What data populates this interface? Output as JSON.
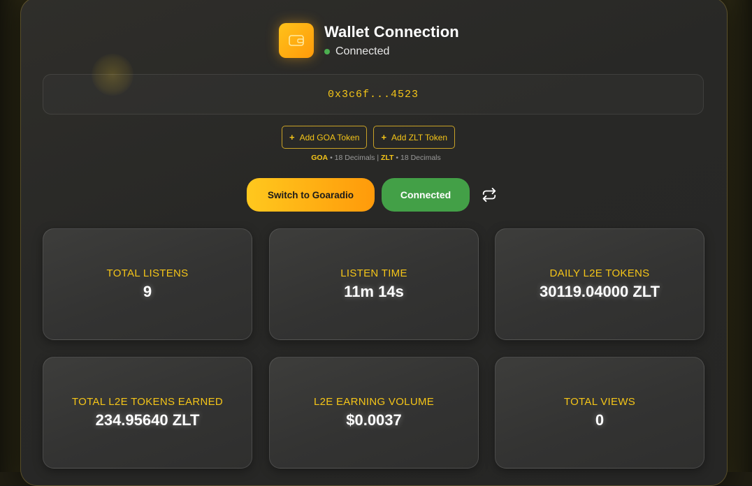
{
  "header": {
    "title": "Wallet Connection",
    "status": "Connected",
    "icon": "wallet-icon",
    "accent_color": "#ffb516",
    "status_color": "#4caf50"
  },
  "wallet": {
    "address": "0x3c6f...4523"
  },
  "tokens": {
    "add_goa_label": "Add GOA Token",
    "add_zlt_label": "Add ZLT Token",
    "goa_symbol": "GOA",
    "goa_decimals": "• 18 Decimals |",
    "zlt_symbol": "ZLT",
    "zlt_decimals": "• 18 Decimals"
  },
  "actions": {
    "switch_label": "Switch to Goaradio",
    "connected_label": "Connected",
    "swap_icon": "swap-arrows-icon"
  },
  "stats": [
    {
      "label": "TOTAL LISTENS",
      "value": "9"
    },
    {
      "label": "LISTEN TIME",
      "value": "11m 14s"
    },
    {
      "label": "DAILY L2E TOKENS",
      "value": "30119.04000 ZLT"
    },
    {
      "label": "TOTAL L2E TOKENS EARNED",
      "value": "234.95640 ZLT"
    },
    {
      "label": "L2E EARNING VOLUME",
      "value": "$0.0037"
    },
    {
      "label": "TOTAL VIEWS",
      "value": "0"
    }
  ]
}
